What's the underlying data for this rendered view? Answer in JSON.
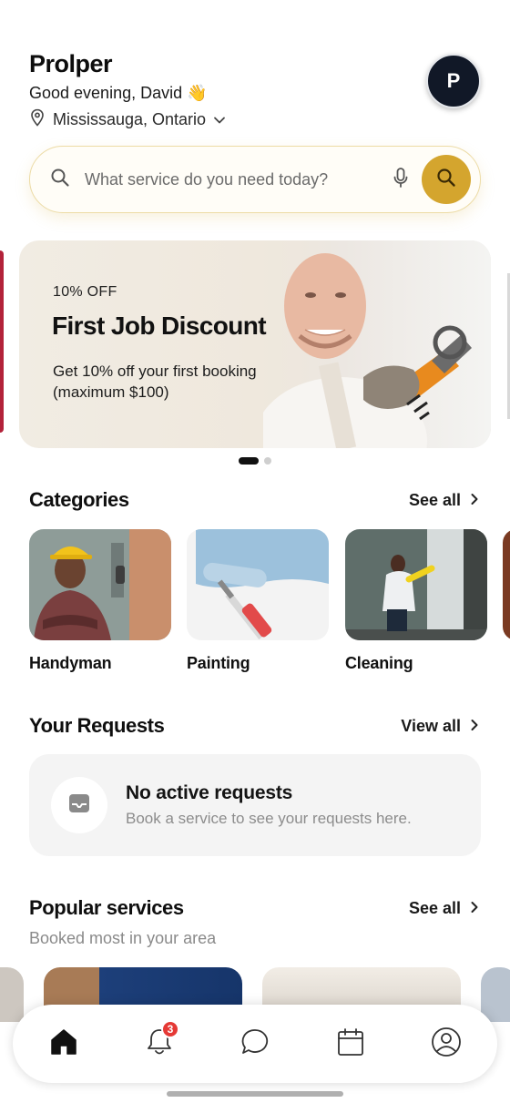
{
  "header": {
    "app_name": "Prolper",
    "greeting": "Good evening, David 👋",
    "location": "Mississauga, Ontario",
    "avatar_initial": "P"
  },
  "search": {
    "placeholder": "What service do you need today?",
    "icons": [
      "search-icon",
      "microphone-icon",
      "search-button-icon"
    ],
    "accent_color": "#d4a52e"
  },
  "banner": {
    "tag": "10% OFF",
    "title": "First Job Discount",
    "description": "Get 10% off your first booking (maximum $100)",
    "pages_total": 2,
    "active_page": 1
  },
  "categories": {
    "title": "Categories",
    "link": "See all",
    "items": [
      {
        "label": "Handyman"
      },
      {
        "label": "Painting"
      },
      {
        "label": "Cleaning"
      }
    ]
  },
  "requests": {
    "title": "Your Requests",
    "link": "View all",
    "empty_title": "No active requests",
    "empty_subtitle": "Book a service to see your requests here."
  },
  "popular": {
    "title": "Popular services",
    "subtitle": "Booked most in your area",
    "link": "See all"
  },
  "tabbar": {
    "items": [
      "home-icon",
      "bell-icon",
      "chat-icon",
      "calendar-icon",
      "profile-icon"
    ],
    "notification_count": "3",
    "badge_color": "#e53935"
  }
}
